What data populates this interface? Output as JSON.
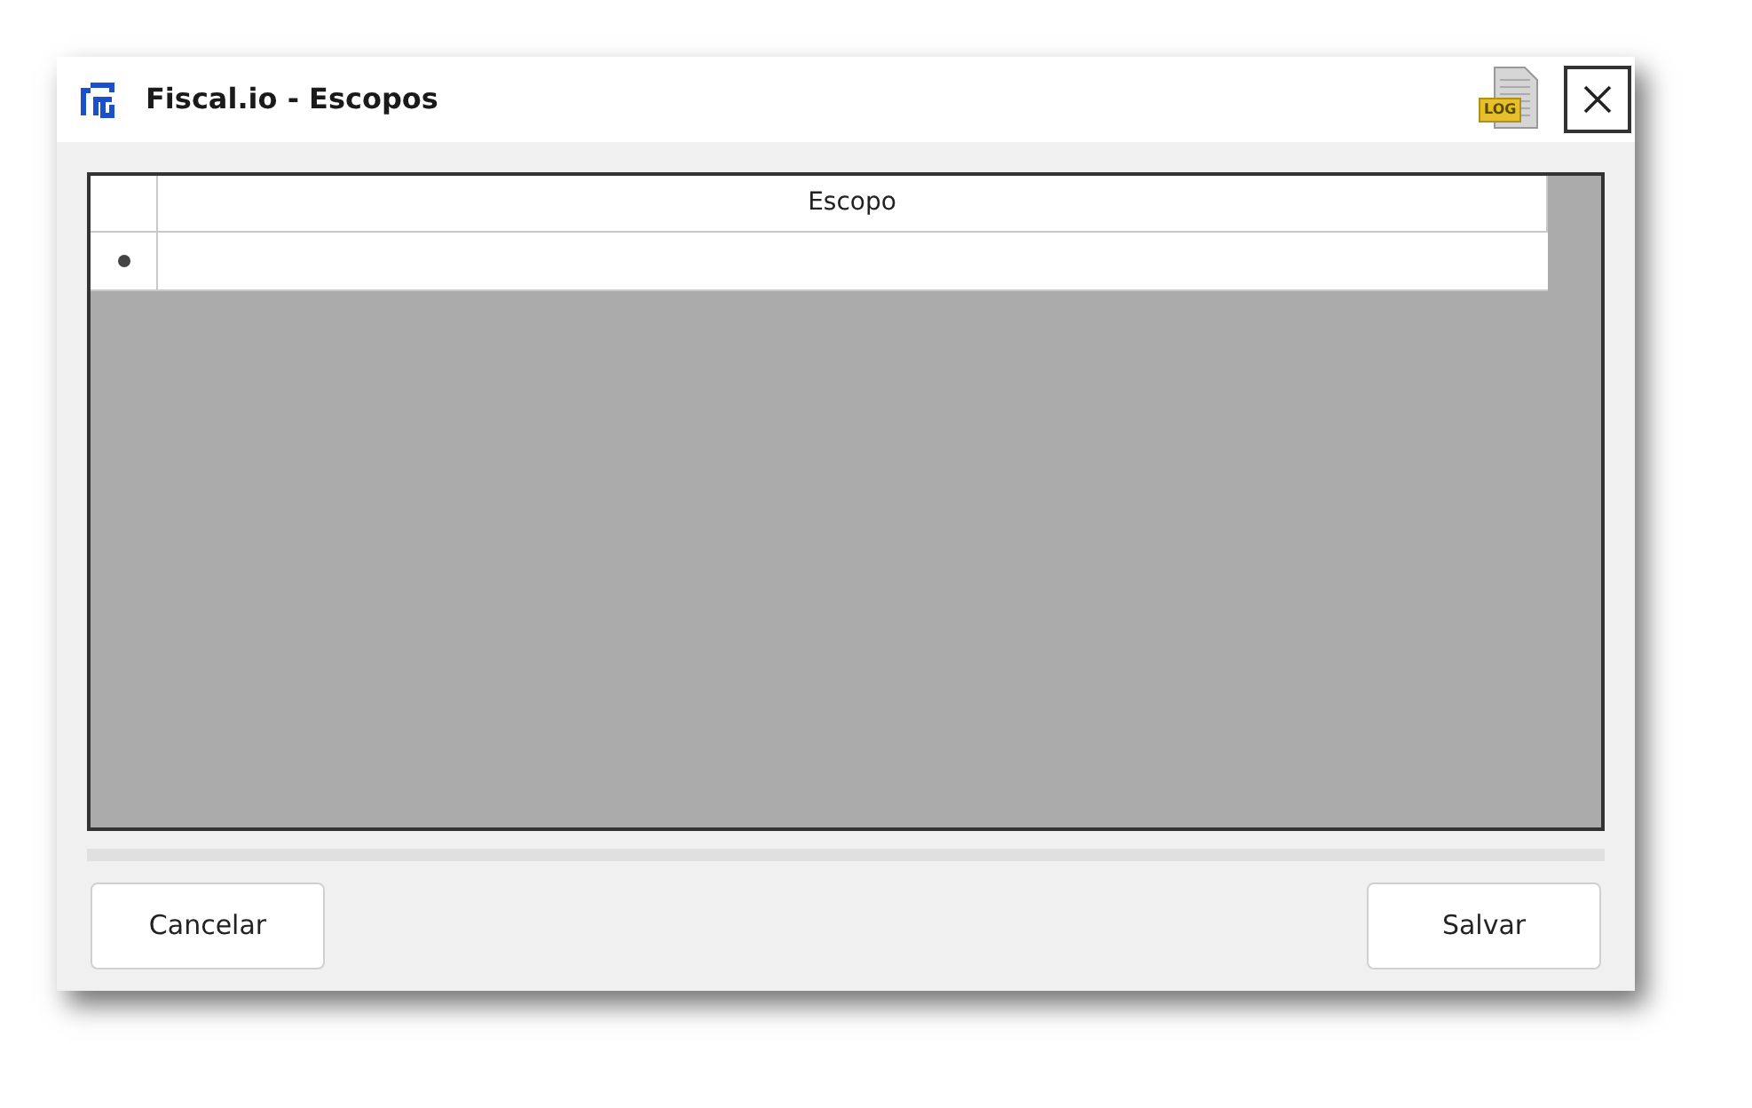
{
  "window": {
    "title": "Fiscal.io - Escopos",
    "log_icon_label": "LOG"
  },
  "table": {
    "columns": [
      "Escopo"
    ],
    "new_row": {
      "marked": true
    }
  },
  "buttons": [
    {
      "label": "Cancelar"
    },
    {
      "label": "Salvar"
    }
  ]
}
